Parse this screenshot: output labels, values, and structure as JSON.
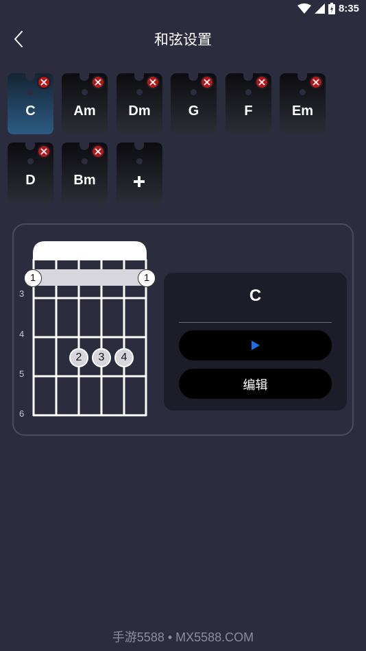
{
  "status_bar": {
    "time": "8:35"
  },
  "header": {
    "title": "和弦设置"
  },
  "chords": [
    {
      "label": "C",
      "selected": true
    },
    {
      "label": "Am",
      "selected": false
    },
    {
      "label": "Dm",
      "selected": false
    },
    {
      "label": "G",
      "selected": false
    },
    {
      "label": "F",
      "selected": false
    },
    {
      "label": "Em",
      "selected": false
    },
    {
      "label": "D",
      "selected": false
    },
    {
      "label": "Bm",
      "selected": false
    }
  ],
  "add_chord_icon": "plus-icon",
  "diagram": {
    "fret_numbers": [
      "3",
      "4",
      "5",
      "6"
    ],
    "barre": {
      "left_finger": "1",
      "right_finger": "1"
    },
    "fingers": [
      "2",
      "3",
      "4"
    ]
  },
  "card": {
    "chord_name": "C",
    "play_icon": "play-icon",
    "edit_label": "编辑"
  },
  "watermark": "手游5588 • MX5588.COM",
  "colors": {
    "background": "#2b2c3d",
    "selected_tile": "#2c5c84",
    "delete_badge": "#b5181b",
    "play_accent": "#1f6fe0"
  }
}
